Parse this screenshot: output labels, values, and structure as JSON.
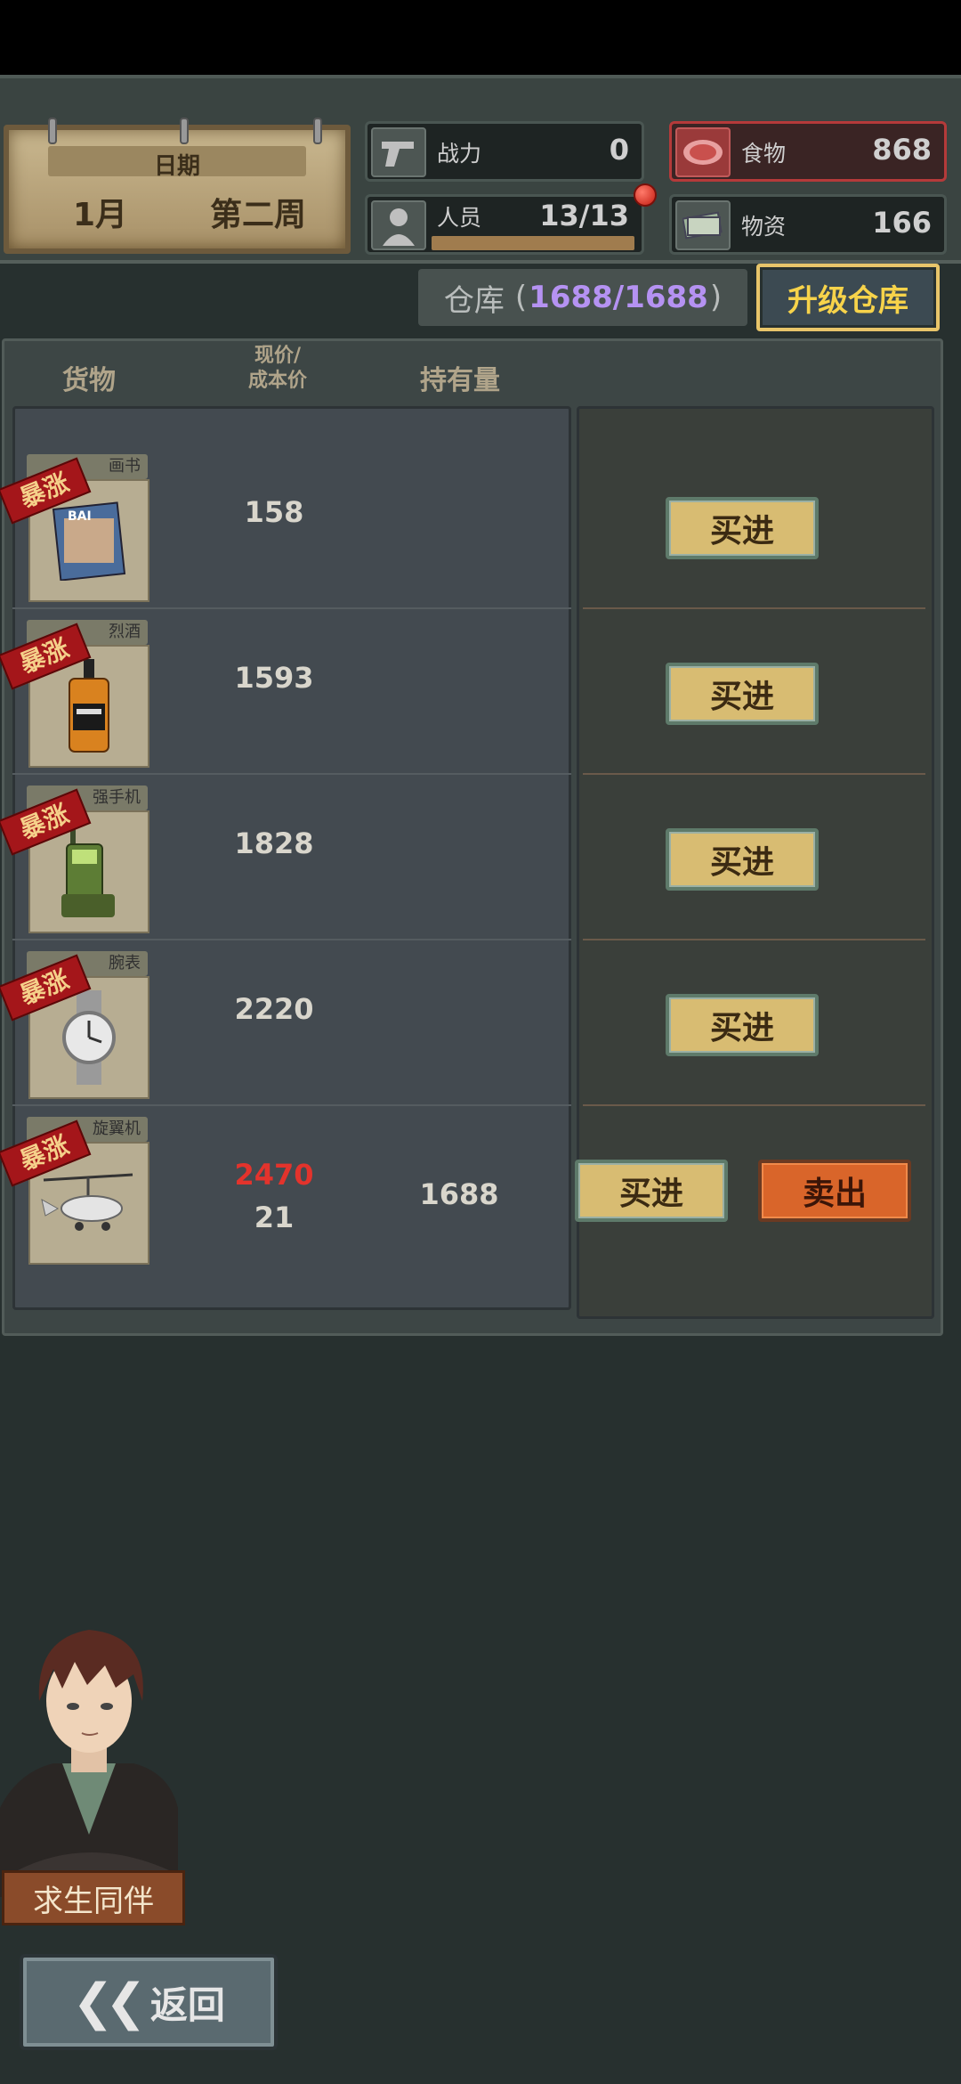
{
  "date": {
    "label": "日期",
    "month": "1月",
    "week": "第二周"
  },
  "stats": {
    "power": {
      "label": "战力",
      "value": "0",
      "icon": "pistol-icon"
    },
    "crew": {
      "label": "人员",
      "value": "13/13",
      "icon": "person-icon"
    },
    "food": {
      "label": "食物",
      "value": "868",
      "icon": "meat-icon"
    },
    "supplies": {
      "label": "物资",
      "value": "166",
      "icon": "cash-icon"
    }
  },
  "warehouse": {
    "label": "仓库",
    "open": "(",
    "capacity": "1688/1688",
    "close": ")",
    "upgrade_label": "升级仓库"
  },
  "columns": {
    "goods": "货物",
    "price_line1": "现价/",
    "price_line2": "成本价",
    "holding": "持有量"
  },
  "items": [
    {
      "name": "画书",
      "tag": "暴涨",
      "price": "158",
      "cost": "",
      "holding": "",
      "buy": "买进",
      "icon": "magazine-icon"
    },
    {
      "name": "烈酒",
      "tag": "暴涨",
      "price": "1593",
      "cost": "",
      "holding": "",
      "buy": "买进",
      "icon": "whiskey-icon"
    },
    {
      "name": "强手机",
      "tag": "暴涨",
      "price": "1828",
      "cost": "",
      "holding": "",
      "buy": "买进",
      "icon": "radio-phone-icon"
    },
    {
      "name": "腕表",
      "tag": "暴涨",
      "price": "2220",
      "cost": "",
      "holding": "",
      "buy": "买进",
      "icon": "watch-icon"
    },
    {
      "name": "旋翼机",
      "tag": "暴涨",
      "price": "2470",
      "cost": "21",
      "holding": "1688",
      "buy": "买进",
      "sell": "卖出",
      "icon": "gyrocopter-icon"
    }
  ],
  "companion_label": "求生同伴",
  "back_label": "返回",
  "colors": {
    "background": "#27302f",
    "accent_gold": "#f7d34a",
    "capacity_purple": "#b592f2",
    "price_up_red": "#e3332c",
    "sell_orange": "#d9652a"
  }
}
